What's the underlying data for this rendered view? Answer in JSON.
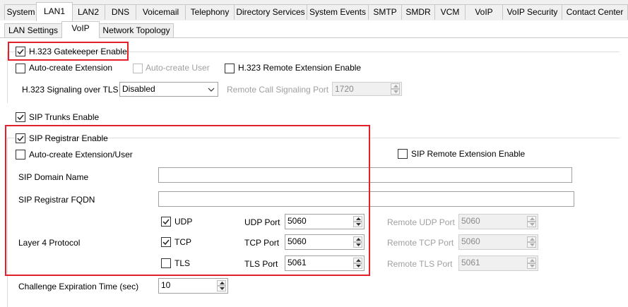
{
  "top_tabs": [
    "System",
    "LAN1",
    "LAN2",
    "DNS",
    "Voicemail",
    "Telephony",
    "Directory Services",
    "System Events",
    "SMTP",
    "SMDR",
    "VCM",
    "VoIP",
    "VoIP Security",
    "Contact Center"
  ],
  "sub_tabs": [
    "LAN Settings",
    "VoIP",
    "Network Topology"
  ],
  "h323": {
    "gatekeeper_label": "H.323 Gatekeeper Enable",
    "auto_create_ext_label": "Auto-create Extension",
    "auto_create_user_label": "Auto-create User",
    "remote_ext_label": "H.323 Remote Extension Enable",
    "signaling_tls_label": "H.323 Signaling over TLS",
    "signaling_tls_value": "Disabled",
    "remote_call_port_label": "Remote Call Signaling Port",
    "remote_call_port_value": "1720"
  },
  "sip": {
    "trunks_label": "SIP Trunks Enable",
    "registrar_label": "SIP Registrar Enable",
    "auto_create_label": "Auto-create Extension/User",
    "remote_ext_label": "SIP Remote Extension Enable",
    "domain_label": "SIP Domain Name",
    "domain_value": "",
    "fqdn_label": "SIP Registrar FQDN",
    "fqdn_value": "",
    "layer4_label": "Layer 4 Protocol",
    "udp_label": "UDP",
    "tcp_label": "TCP",
    "tls_label": "TLS",
    "udp_port_label": "UDP Port",
    "udp_port_value": "5060",
    "tcp_port_label": "TCP Port",
    "tcp_port_value": "5060",
    "tls_port_label": "TLS Port",
    "tls_port_value": "5061",
    "remote_udp_label": "Remote UDP Port",
    "remote_udp_value": "5060",
    "remote_tcp_label": "Remote TCP Port",
    "remote_tcp_value": "5060",
    "remote_tls_label": "Remote TLS Port",
    "remote_tls_value": "5061",
    "challenge_label": "Challenge Expiration Time (sec)",
    "challenge_value": "10"
  },
  "colors": {
    "highlight": "#e3202a",
    "disabled_text": "#a0a0a0"
  }
}
